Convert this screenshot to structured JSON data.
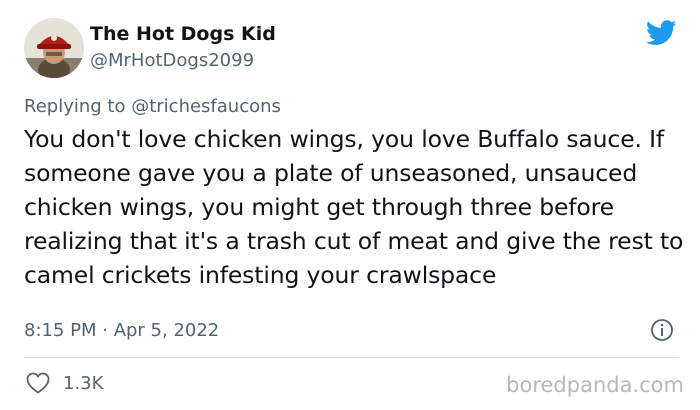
{
  "author": {
    "display_name": "The Hot Dogs Kid",
    "handle": "@MrHotDogs2099",
    "avatar_icon": "person-in-red-cap-avatar"
  },
  "reply": {
    "prefix": "Replying to",
    "to_handle": "@trichesfaucons"
  },
  "tweet": {
    "text": "You don't love chicken wings, you love Buffalo sauce. If someone gave you a plate of unseasoned, unsauced chicken wings, you might get through three before realizing that it's a trash cut of meat and give the rest to camel crickets infesting your crawlspace",
    "timestamp": "8:15 PM · Apr 5, 2022"
  },
  "actions": {
    "like_count": "1.3K",
    "like_icon": "heart-icon",
    "info_icon": "info-icon"
  },
  "brand": {
    "icon": "twitter-bird-icon",
    "accent": "#1d9bf0",
    "watermark": "boredpanda.com"
  },
  "colors": {
    "text_primary": "#0f1419",
    "text_secondary": "#536471",
    "divider": "#cfd9de",
    "watermark": "#b8b8b8"
  }
}
